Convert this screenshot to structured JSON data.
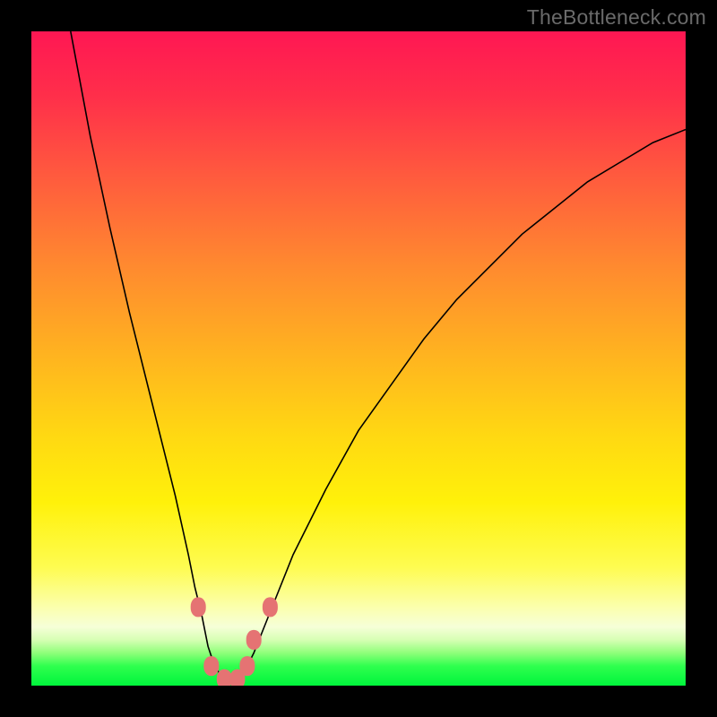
{
  "watermark": "TheBottleneck.com",
  "chart_data": {
    "type": "line",
    "title": "",
    "xlabel": "",
    "ylabel": "",
    "xlim": [
      0,
      100
    ],
    "ylim": [
      0,
      100
    ],
    "grid": false,
    "legend": false,
    "background_gradient": {
      "stops": [
        {
          "pos": 0.0,
          "color": "#ff1753"
        },
        {
          "pos": 0.1,
          "color": "#ff2f4a"
        },
        {
          "pos": 0.22,
          "color": "#ff5a3e"
        },
        {
          "pos": 0.36,
          "color": "#ff8a2f"
        },
        {
          "pos": 0.5,
          "color": "#ffb51f"
        },
        {
          "pos": 0.62,
          "color": "#ffd912"
        },
        {
          "pos": 0.72,
          "color": "#fff10a"
        },
        {
          "pos": 0.82,
          "color": "#fefc52"
        },
        {
          "pos": 0.88,
          "color": "#fbffad"
        },
        {
          "pos": 0.91,
          "color": "#f6ffd8"
        },
        {
          "pos": 0.93,
          "color": "#d7ffb4"
        },
        {
          "pos": 0.95,
          "color": "#8fff7a"
        },
        {
          "pos": 0.97,
          "color": "#2fff4e"
        },
        {
          "pos": 1.0,
          "color": "#00f53c"
        }
      ]
    },
    "series": [
      {
        "name": "curve",
        "x": [
          6,
          9,
          12,
          15,
          18,
          20,
          22,
          24,
          25,
          26,
          27,
          28,
          29,
          30,
          31,
          32,
          33,
          34,
          36,
          40,
          45,
          50,
          55,
          60,
          65,
          70,
          75,
          80,
          85,
          90,
          95,
          100
        ],
        "y": [
          100,
          84,
          70,
          57,
          45,
          37,
          29,
          20,
          15,
          11,
          6,
          3,
          1.5,
          1,
          1,
          1.5,
          3,
          5,
          10,
          20,
          30,
          39,
          46,
          53,
          59,
          64,
          69,
          73,
          77,
          80,
          83,
          85
        ]
      }
    ],
    "markers": [
      {
        "x": 25.5,
        "y": 12
      },
      {
        "x": 27.5,
        "y": 3
      },
      {
        "x": 29.5,
        "y": 1
      },
      {
        "x": 31.5,
        "y": 1
      },
      {
        "x": 33.0,
        "y": 3
      },
      {
        "x": 34.0,
        "y": 7
      },
      {
        "x": 36.5,
        "y": 12
      }
    ]
  }
}
